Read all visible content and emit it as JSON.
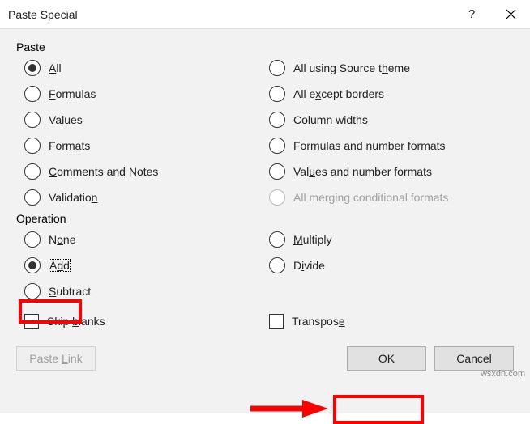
{
  "titlebar": {
    "title": "Paste Special"
  },
  "paste": {
    "label": "Paste",
    "items": [
      {
        "key": "all",
        "label_pre": "",
        "u": "A",
        "label_post": "ll",
        "selected": true
      },
      {
        "key": "all-using-source-theme",
        "label_pre": "All using Source t",
        "u": "h",
        "label_post": "eme",
        "selected": false
      },
      {
        "key": "formulas",
        "label_pre": "",
        "u": "F",
        "label_post": "ormulas",
        "selected": false
      },
      {
        "key": "all-except-borders",
        "label_pre": "All e",
        "u": "x",
        "label_post": "cept borders",
        "selected": false
      },
      {
        "key": "values",
        "label_pre": "",
        "u": "V",
        "label_post": "alues",
        "selected": false
      },
      {
        "key": "column-widths",
        "label_pre": "Column ",
        "u": "w",
        "label_post": "idths",
        "selected": false
      },
      {
        "key": "formats",
        "label_pre": "Forma",
        "u": "t",
        "label_post": "s",
        "selected": false
      },
      {
        "key": "formulas-and-number-formats",
        "label_pre": "Fo",
        "u": "r",
        "label_post": "mulas and number formats",
        "selected": false
      },
      {
        "key": "comments-and-notes",
        "label_pre": "",
        "u": "C",
        "label_post": "omments and Notes",
        "selected": false
      },
      {
        "key": "values-and-number-formats",
        "label_pre": "Val",
        "u": "u",
        "label_post": "es and number formats",
        "selected": false
      },
      {
        "key": "validation",
        "label_pre": "Validatio",
        "u": "n",
        "label_post": "",
        "selected": false
      },
      {
        "key": "all-merging-conditional",
        "label_pre": "All merging conditional formats",
        "u": "",
        "label_post": "",
        "selected": false,
        "disabled": true
      }
    ]
  },
  "operation": {
    "label": "Operation",
    "items": [
      {
        "key": "none",
        "label_pre": "N",
        "u": "o",
        "label_post": "ne",
        "selected": false
      },
      {
        "key": "multiply",
        "label_pre": "",
        "u": "M",
        "label_post": "ultiply",
        "selected": false
      },
      {
        "key": "add",
        "label_pre": "A",
        "u": "d",
        "label_post": "d",
        "selected": true,
        "focused": true
      },
      {
        "key": "divide",
        "label_pre": "D",
        "u": "i",
        "label_post": "vide",
        "selected": false
      },
      {
        "key": "subtract",
        "label_pre": "",
        "u": "S",
        "label_post": "ubtract",
        "selected": false
      }
    ]
  },
  "checks": {
    "skip_blanks_pre": "Skip ",
    "skip_blanks_u": "b",
    "skip_blanks_post": "lanks",
    "transpose_pre": "Transpos",
    "transpose_u": "e",
    "transpose_post": ""
  },
  "buttons": {
    "paste_link_pre": "Paste ",
    "paste_link_u": "L",
    "paste_link_post": "ink",
    "ok": "OK",
    "cancel": "Cancel"
  },
  "watermark": "wsxdn.com"
}
